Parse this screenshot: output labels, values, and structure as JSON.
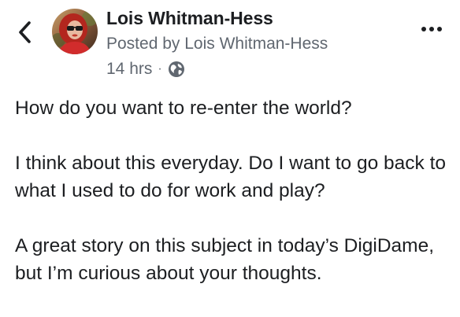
{
  "header": {
    "back_icon": "chevron-left-icon",
    "author_name": "Lois Whitman-Hess",
    "posted_by": "Posted by Lois Whitman-Hess",
    "timestamp": "14 hrs",
    "separator": "·",
    "privacy_icon": "globe-icon",
    "more_icon": "more-dots-icon"
  },
  "post": {
    "paragraphs": [
      "How do you want to re-enter the world?",
      "I think about this everyday. Do I want to go back to what I used to do for work and play?",
      "A great story on this subject in today’s DigiDame, but I’m curious about your thoughts."
    ]
  },
  "colors": {
    "text_primary": "#1c1e21",
    "text_secondary": "#606770",
    "background": "#ffffff"
  }
}
